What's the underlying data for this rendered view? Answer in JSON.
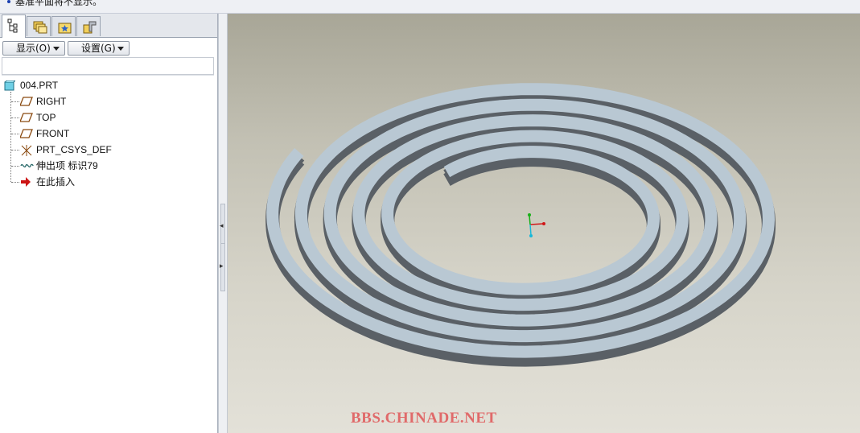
{
  "message_bar": {
    "text": "基准平面将不显示。"
  },
  "navigator": {
    "tabs": [
      {
        "name": "model-tree",
        "icon": "model-tree-icon"
      },
      {
        "name": "folder-browser",
        "icon": "folder-browser-icon"
      },
      {
        "name": "favorites",
        "icon": "favorites-icon"
      },
      {
        "name": "connections",
        "icon": "connections-icon"
      }
    ],
    "show_button": "显示(O)",
    "settings_button": "设置(G)"
  },
  "model_tree": {
    "root": "004.PRT",
    "items": [
      {
        "label": "RIGHT",
        "icon": "datum-plane-icon"
      },
      {
        "label": "TOP",
        "icon": "datum-plane-icon"
      },
      {
        "label": "FRONT",
        "icon": "datum-plane-icon"
      },
      {
        "label": "PRT_CSYS_DEF",
        "icon": "coordinate-system-icon"
      },
      {
        "label": "伸出项 标识79",
        "icon": "protrusion-feature-icon"
      },
      {
        "label": "在此插入",
        "icon": "insert-here-arrow-icon"
      }
    ]
  },
  "viewport": {
    "watermark": "BBS.CHINADE.NET",
    "model_top_color": "#b9c8d3",
    "model_side_color": "#5a6066"
  }
}
